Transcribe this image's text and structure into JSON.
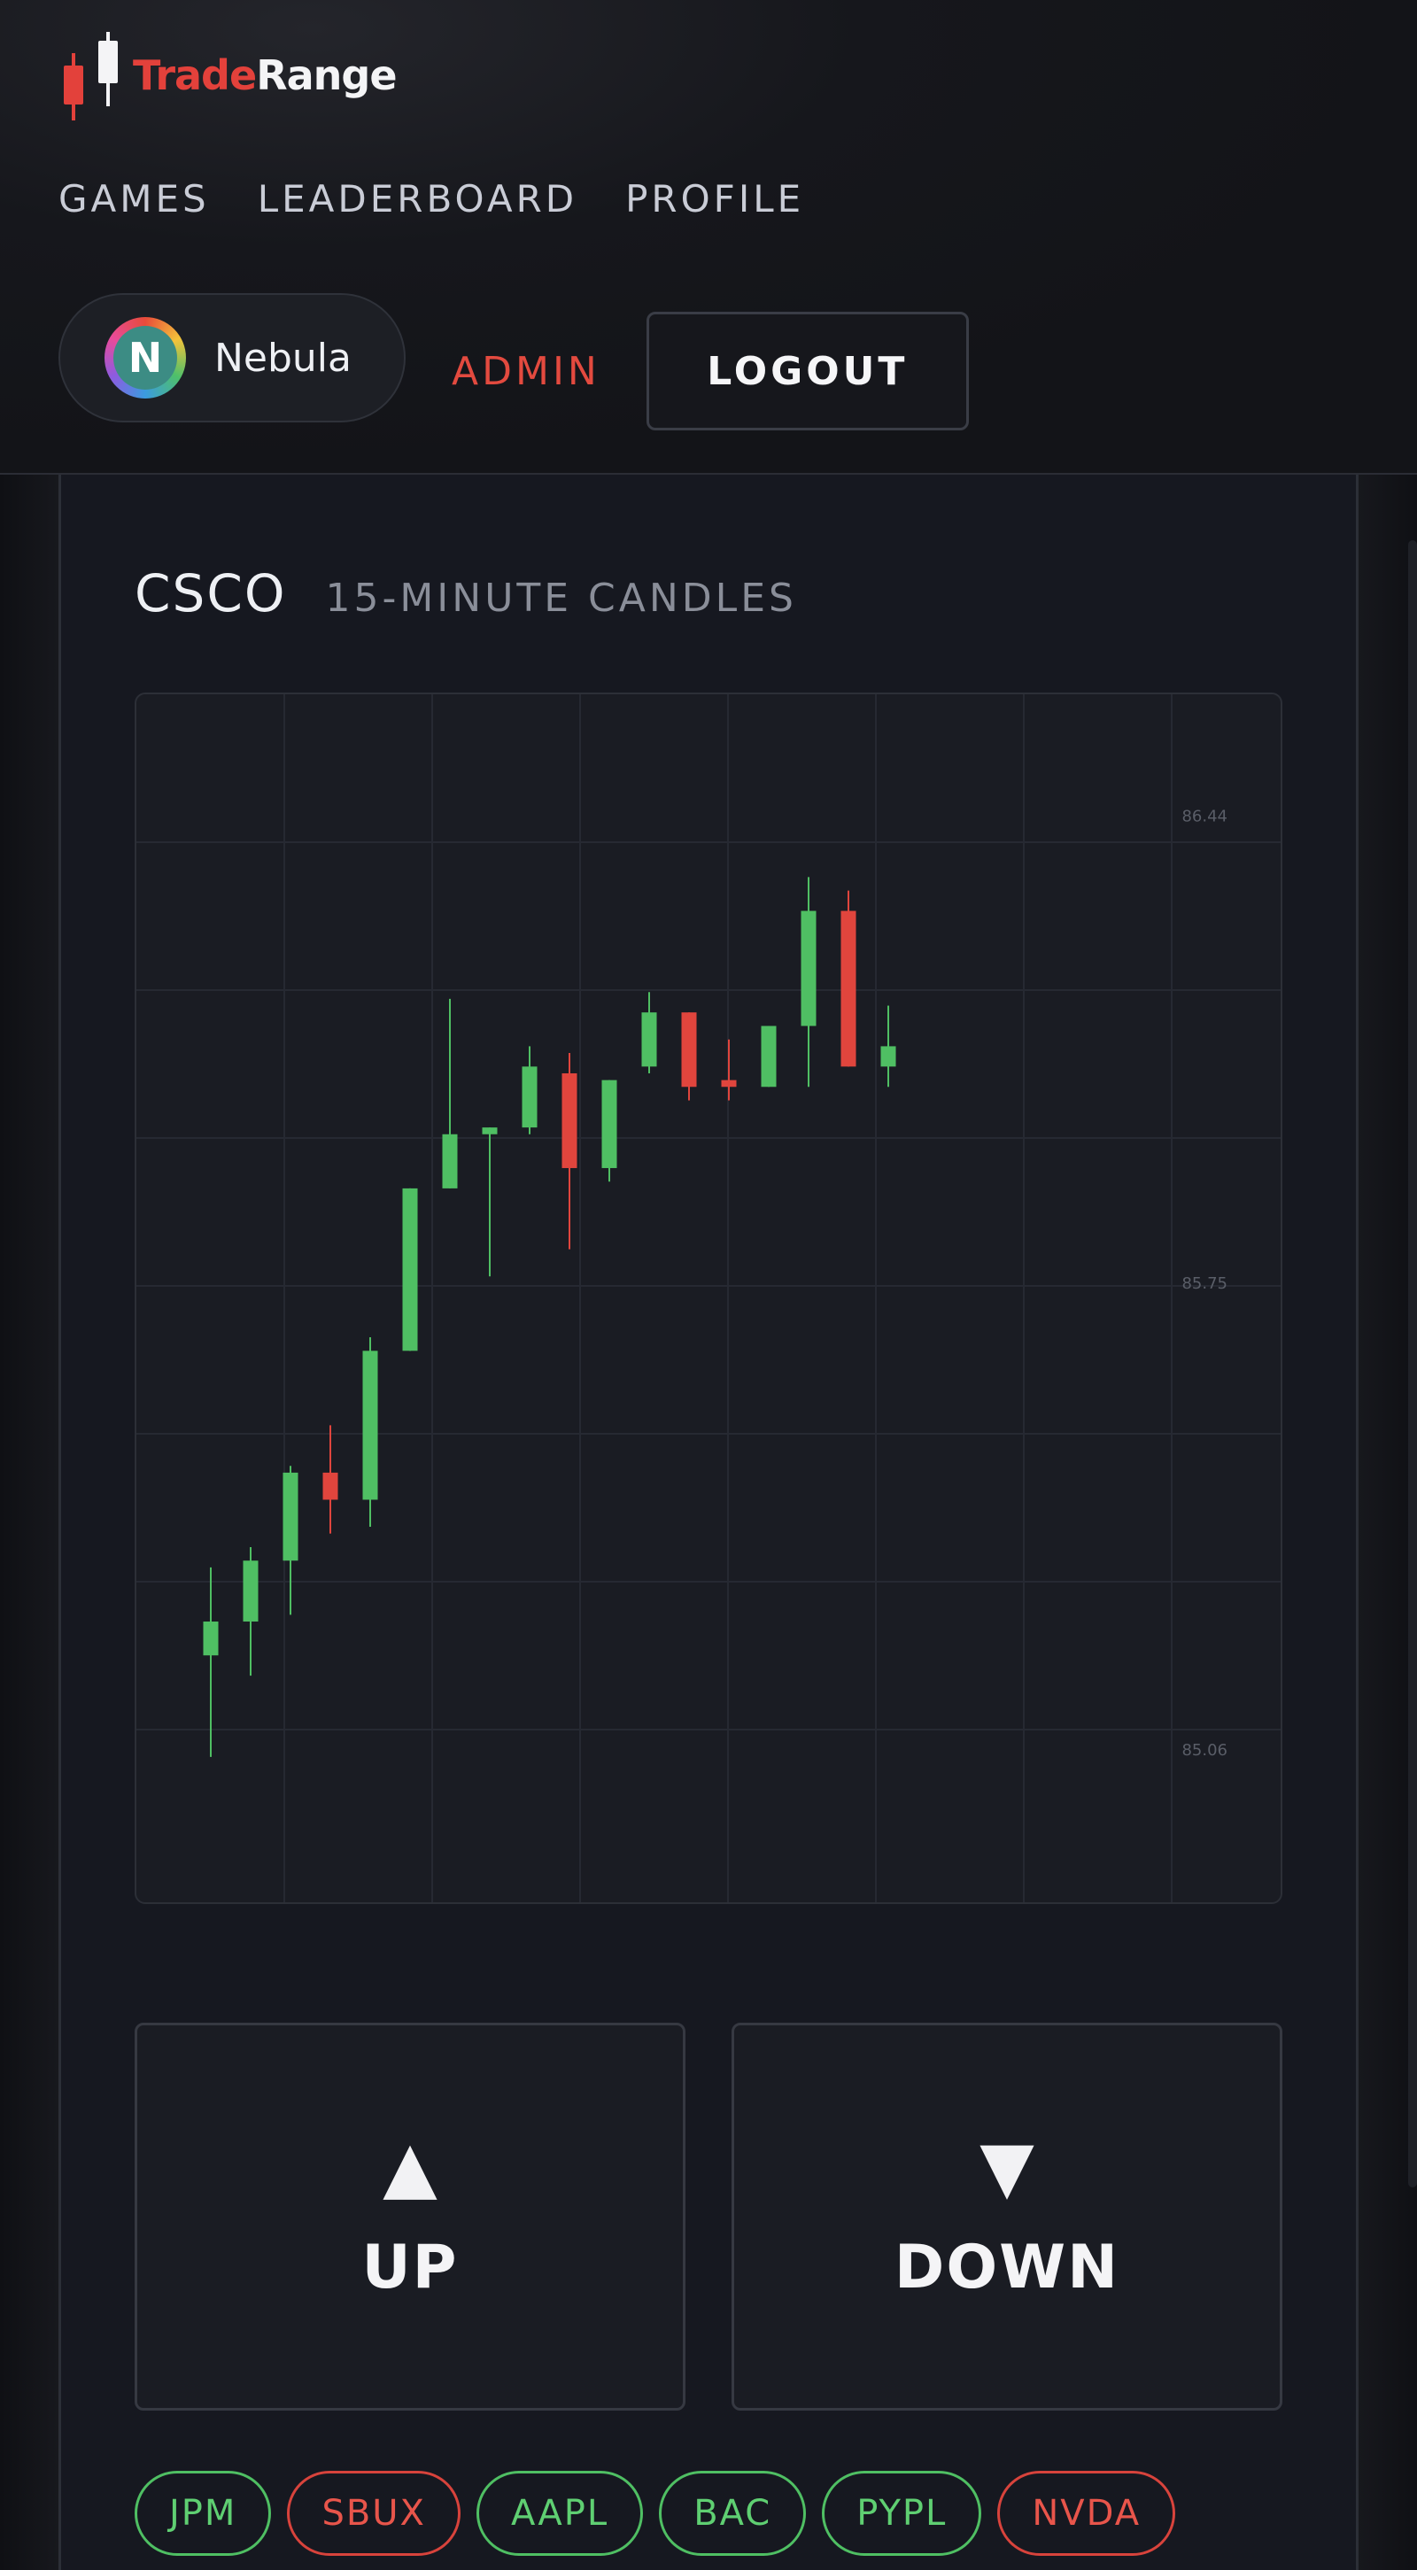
{
  "brand": {
    "name_part1": "Trade",
    "name_part2": "Range",
    "accent_color": "#e3413b"
  },
  "nav": {
    "items": [
      "GAMES",
      "LEADERBOARD",
      "PROFILE"
    ]
  },
  "user": {
    "avatar_letter": "N",
    "name": "Nebula",
    "admin_label": "ADMIN",
    "logout_label": "LOGOUT"
  },
  "chart": {
    "ticker": "CSCO",
    "subtitle": "15-MINUTE CANDLES"
  },
  "chart_data": {
    "type": "candlestick",
    "title": "CSCO",
    "subtitle": "15-MINUTE CANDLES",
    "y_ticks": [
      "86.44",
      "85.75",
      "85.06"
    ],
    "ylim": [
      84.83,
      86.62
    ],
    "colors": {
      "up": "#4fbf63",
      "down": "#e0453d",
      "grid": "#262932",
      "tick_label": "#5a5e68"
    },
    "candles": [
      {
        "open": 85.2,
        "high": 85.33,
        "low": 85.05,
        "close": 85.25
      },
      {
        "open": 85.25,
        "high": 85.36,
        "low": 85.17,
        "close": 85.34
      },
      {
        "open": 85.34,
        "high": 85.48,
        "low": 85.26,
        "close": 85.47
      },
      {
        "open": 85.47,
        "high": 85.54,
        "low": 85.38,
        "close": 85.43
      },
      {
        "open": 85.43,
        "high": 85.67,
        "low": 85.39,
        "close": 85.65
      },
      {
        "open": 85.65,
        "high": 85.89,
        "low": 85.65,
        "close": 85.89
      },
      {
        "open": 85.89,
        "high": 86.17,
        "low": 85.89,
        "close": 85.97
      },
      {
        "open": 85.97,
        "high": 85.98,
        "low": 85.76,
        "close": 85.98
      },
      {
        "open": 85.98,
        "high": 86.1,
        "low": 85.97,
        "close": 86.07
      },
      {
        "open": 86.06,
        "high": 86.09,
        "low": 85.8,
        "close": 85.92
      },
      {
        "open": 85.92,
        "high": 86.05,
        "low": 85.9,
        "close": 86.05
      },
      {
        "open": 86.07,
        "high": 86.18,
        "low": 86.06,
        "close": 86.15
      },
      {
        "open": 86.15,
        "high": 86.14,
        "low": 86.02,
        "close": 86.04
      },
      {
        "open": 86.05,
        "high": 86.11,
        "low": 86.02,
        "close": 86.04
      },
      {
        "open": 86.04,
        "high": 86.13,
        "low": 86.04,
        "close": 86.13
      },
      {
        "open": 86.13,
        "high": 86.35,
        "low": 86.04,
        "close": 86.3
      },
      {
        "open": 86.3,
        "high": 86.33,
        "low": 86.07,
        "close": 86.07
      },
      {
        "open": 86.07,
        "high": 86.16,
        "low": 86.04,
        "close": 86.1
      }
    ]
  },
  "actions": {
    "up_symbol": "▲",
    "up_label": "UP",
    "down_symbol": "▼",
    "down_label": "DOWN"
  },
  "tickers": [
    {
      "symbol": "JPM",
      "direction": "up"
    },
    {
      "symbol": "SBUX",
      "direction": "down"
    },
    {
      "symbol": "AAPL",
      "direction": "up"
    },
    {
      "symbol": "BAC",
      "direction": "up"
    },
    {
      "symbol": "PYPL",
      "direction": "up"
    },
    {
      "symbol": "NVDA",
      "direction": "down"
    }
  ]
}
